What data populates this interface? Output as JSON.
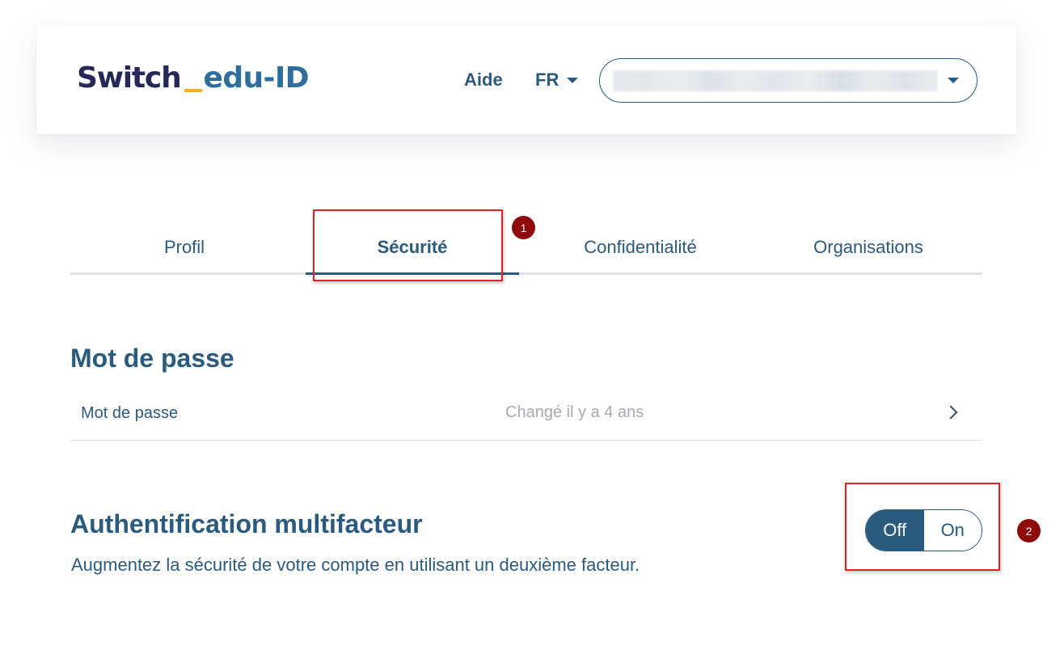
{
  "header": {
    "logo": {
      "switch": "Switch",
      "product": "edu-ID"
    },
    "help_label": "Aide",
    "language": "FR"
  },
  "tabs": [
    {
      "label": "Profil",
      "active": false
    },
    {
      "label": "Sécurité",
      "active": true
    },
    {
      "label": "Confidentialité",
      "active": false
    },
    {
      "label": "Organisations",
      "active": false
    }
  ],
  "password_section": {
    "title": "Mot de passe",
    "row_label": "Mot de passe",
    "row_status": "Changé il y a 4 ans"
  },
  "mfa_section": {
    "title": "Authentification multifacteur",
    "description": "Augmentez la sécurité de votre compte en utilisant un deuxième facteur.",
    "toggle": {
      "off_label": "Off",
      "on_label": "On",
      "selected": "Off"
    }
  },
  "annotations": [
    "1",
    "2"
  ],
  "colors": {
    "primary": "#2a5a7e",
    "logo_dark": "#26285a",
    "logo_accent": "#f3b21c",
    "annotation_red": "#e12323",
    "badge": "#8f0a0a"
  }
}
